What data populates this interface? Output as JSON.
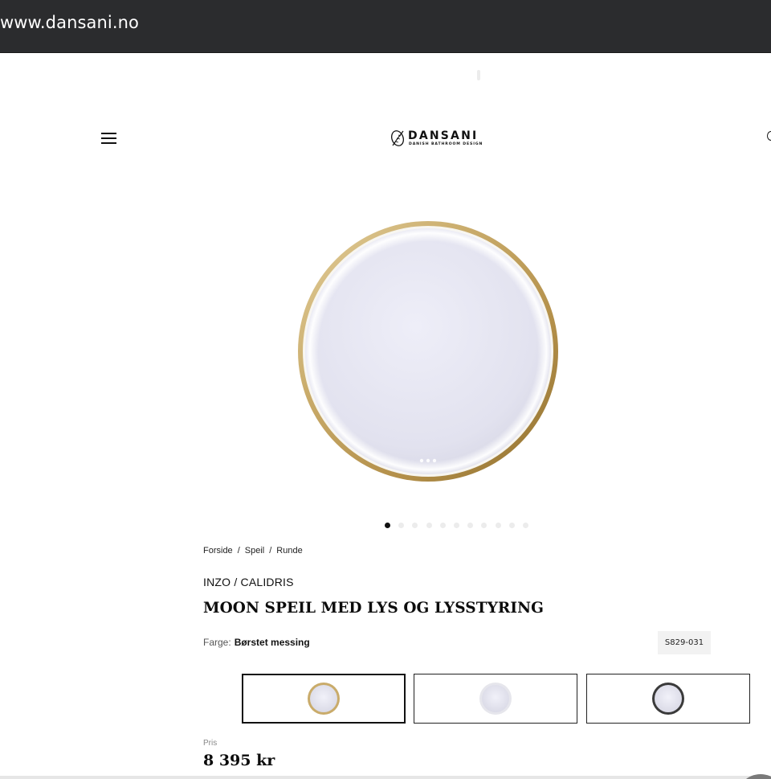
{
  "browser": {
    "url": "www.dansani.no"
  },
  "header": {
    "logo_name": "DANSANI",
    "logo_tagline": "DANISH BATHROOM DESIGN"
  },
  "gallery": {
    "image_count": 11,
    "active_index": 0
  },
  "breadcrumb": [
    {
      "label": "Forside"
    },
    {
      "label": "Speil"
    },
    {
      "label": "Runde"
    }
  ],
  "breadcrumb_separator": "/",
  "product": {
    "brand_line": "INZO / CALIDRIS",
    "title": "MOON SPEIL MED LYS OG LYSSTYRING",
    "color_label": "Farge:",
    "color_value": "Børstet messing",
    "sku": "S829-031",
    "price_label": "Pris",
    "price": "8 395 kr"
  },
  "variants": [
    {
      "name": "brushed-brass",
      "frame_color": "#c9ab6a",
      "selected": true
    },
    {
      "name": "white",
      "frame_color": "#e6e6ec",
      "selected": false
    },
    {
      "name": "black",
      "frame_color": "#3a3a3a",
      "selected": false
    }
  ],
  "colors": {
    "toolbar_bg": "#2b2c2e",
    "text_primary": "#111111",
    "brass": "#c9ab6a",
    "sku_bg": "#f2f2f2"
  }
}
